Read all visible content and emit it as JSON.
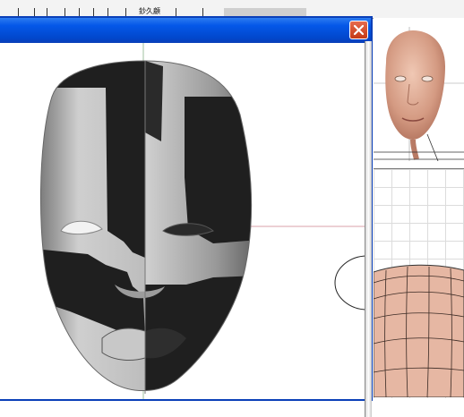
{
  "background": {
    "toolbar_label": "鈔久顧",
    "top_strip_color": "#f3f3f3"
  },
  "dialog": {
    "titlebar_color": "#0558e8",
    "close_icon": "close-icon",
    "content": "3d-face-model-viewport"
  },
  "right_panel": {
    "thumbnail_icon": "face-thumbnail",
    "mesh_icon": "mesh-preview"
  },
  "colors": {
    "skin": "#e6b7a3",
    "mask_dark": "#1f1f1f",
    "mask_light": "#c8c8c8",
    "crosshair": "#d9a0a8"
  }
}
